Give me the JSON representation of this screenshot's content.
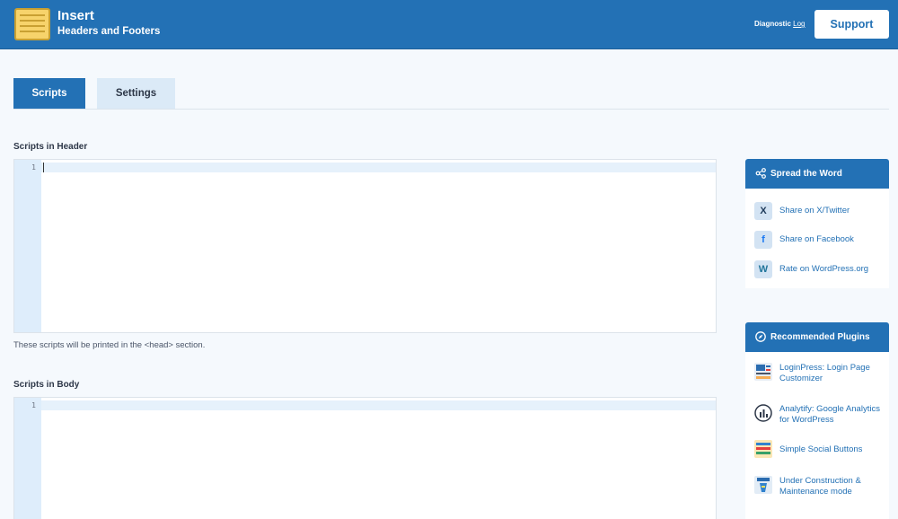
{
  "header": {
    "title": "Insert",
    "subtitle": "Headers and Footers",
    "diagnostic_text": "Diagnostic",
    "log_link": "Log",
    "support_label": "Support"
  },
  "tabs": [
    {
      "label": "Scripts",
      "active": true
    },
    {
      "label": "Settings",
      "active": false
    }
  ],
  "sections": {
    "header_scripts": {
      "label": "Scripts in Header",
      "line_number": "1",
      "value": "",
      "hint": "These scripts will be printed in the <head> section."
    },
    "body_scripts": {
      "label": "Scripts in Body",
      "line_number": "1",
      "value": ""
    }
  },
  "sidebar": {
    "spread": {
      "title": "Spread the Word",
      "items": [
        {
          "label": "Share on X/Twitter",
          "icon": "x-twitter-icon"
        },
        {
          "label": "Share on Facebook",
          "icon": "facebook-icon"
        },
        {
          "label": "Rate on WordPress.org",
          "icon": "wordpress-icon"
        }
      ]
    },
    "recommended": {
      "title": "Recommended Plugins",
      "items": [
        {
          "label": "LoginPress: Login Page Customizer",
          "icon": "loginpress-icon"
        },
        {
          "label": "Analytify: Google Analytics for WordPress",
          "icon": "analytify-icon"
        },
        {
          "label": "Simple Social Buttons",
          "icon": "social-buttons-icon"
        },
        {
          "label": "Under Construction & Maintenance mode",
          "icon": "under-construction-icon"
        }
      ]
    }
  },
  "colors": {
    "primary": "#2371b5",
    "background": "#f5f9fd",
    "gutter": "#deedfb"
  }
}
